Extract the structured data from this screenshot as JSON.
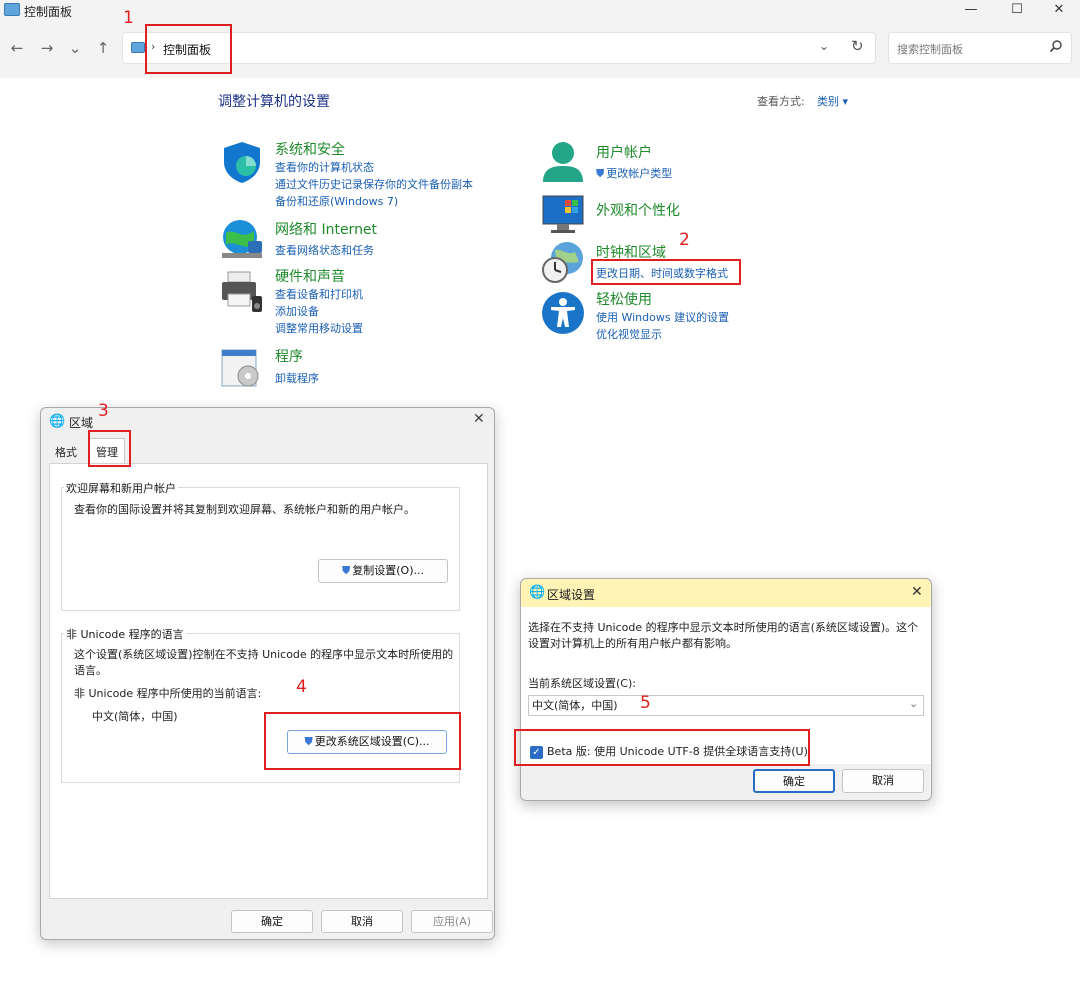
{
  "window": {
    "title": "控制面板",
    "minimize": "—",
    "maximize": "☐",
    "close": "✕"
  },
  "nav": {
    "back": "←",
    "forward": "→",
    "recent": "⌄",
    "up": "↑",
    "breadcrumb": "控制面板",
    "breadcrumb_sep": "›",
    "dropdown": "⌄",
    "refresh": "↻",
    "search_placeholder": "搜索控制面板"
  },
  "main": {
    "page_title": "调整计算机的设置",
    "view_label": "查看方式:",
    "view_value": "类别 ▾"
  },
  "categories": [
    {
      "title": "系统和安全",
      "icon": "shield-icon",
      "links": [
        "查看你的计算机状态",
        "通过文件历史记录保存你的文件备份副本",
        "备份和还原(Windows 7)"
      ]
    },
    {
      "title": "网络和 Internet",
      "icon": "network-icon",
      "links": [
        "查看网络状态和任务"
      ]
    },
    {
      "title": "硬件和声音",
      "icon": "printer-icon",
      "links": [
        "查看设备和打印机",
        "添加设备",
        "调整常用移动设置"
      ]
    },
    {
      "title": "程序",
      "icon": "programs-icon",
      "links": [
        "卸载程序"
      ]
    },
    {
      "title": "用户帐户",
      "icon": "user-icon",
      "links": [
        "更改帐户类型"
      ]
    },
    {
      "title": "外观和个性化",
      "icon": "monitor-icon",
      "links": []
    },
    {
      "title": "时钟和区域",
      "icon": "clock-globe-icon",
      "links": [
        "更改日期、时间或数字格式"
      ]
    },
    {
      "title": "轻松使用",
      "icon": "accessibility-icon",
      "links": [
        "使用 Windows 建议的设置",
        "优化视觉显示"
      ]
    }
  ],
  "annotations": [
    "1",
    "2",
    "3",
    "4",
    "5"
  ],
  "region_dialog": {
    "title": "区域",
    "close": "✕",
    "tabs": [
      "格式",
      "管理"
    ],
    "welcome_group_title": "欢迎屏幕和新用户帐户",
    "welcome_text": "查看你的国际设置并将其复制到欢迎屏幕、系统帐户和新的用户帐户。",
    "copy_button": "复制设置(O)...",
    "nonunicode_group_title": "非 Unicode 程序的语言",
    "nonunicode_text": "这个设置(系统区域设置)控制在不支持 Unicode 的程序中显示文本时所使用的语言。",
    "current_lang_label": "非 Unicode 程序中所使用的当前语言:",
    "current_lang_value": "中文(简体，中国)",
    "change_locale_button": "更改系统区域设置(C)...",
    "ok": "确定",
    "cancel": "取消",
    "apply": "应用(A)"
  },
  "sub_dialog": {
    "title": "区域设置",
    "close": "✕",
    "description": "选择在不支持 Unicode 的程序中显示文本时所使用的语言(系统区域设置)。这个设置对计算机上的所有用户帐户都有影响。",
    "current_label": "当前系统区域设置(C):",
    "current_value": "中文(简体，中国)",
    "select_arrow": "⌄",
    "beta_checkbox_label": "Beta 版: 使用 Unicode UTF-8 提供全球语言支持(U)",
    "beta_checked": true,
    "ok": "确定",
    "cancel": "取消"
  },
  "colors": {
    "category_title": "#1f8a2c",
    "link": "#1a5fb4",
    "page_title": "#1e3287",
    "annotation": "#e02020",
    "sub_dialog_titlebar": "#fff3b6"
  }
}
